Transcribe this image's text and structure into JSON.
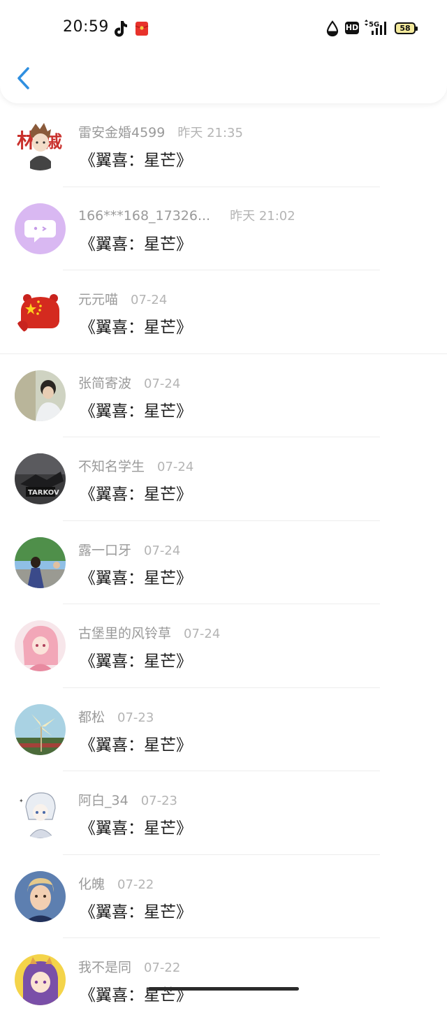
{
  "status_bar": {
    "time": "20:59",
    "network": "5G",
    "hd": "HD",
    "battery": "58"
  },
  "colors": {
    "accent": "#2f8fe0",
    "name_gray": "#9a9a9a"
  },
  "comments": [
    {
      "name": "雷安金婚4599",
      "date": "昨天 21:35",
      "message": "《翼喜：星芒》",
      "avatar": "anime-avatar"
    },
    {
      "name": "166***168_17326...",
      "date": "昨天 21:02",
      "message": "《翼喜：星芒》",
      "avatar": "default-chat-avatar"
    },
    {
      "name": "元元喵",
      "date": "07-24",
      "message": "《翼喜：星芒》",
      "avatar": "red-bear-avatar"
    },
    {
      "name": "张简寄波",
      "date": "07-24",
      "message": "《翼喜：星芒》",
      "avatar": "photo-avatar"
    },
    {
      "name": "不知名学生",
      "date": "07-24",
      "message": "《翼喜：星芒》",
      "avatar": "game-avatar"
    },
    {
      "name": "露一口牙",
      "date": "07-24",
      "message": "《翼喜：星芒》",
      "avatar": "photo-avatar"
    },
    {
      "name": "古堡里的风铃草",
      "date": "07-24",
      "message": "《翼喜：星芒》",
      "avatar": "anime-avatar"
    },
    {
      "name": "都松",
      "date": "07-23",
      "message": "《翼喜：星芒》",
      "avatar": "pinwheel-avatar"
    },
    {
      "name": "阿白_34",
      "date": "07-23",
      "message": "《翼喜：星芒》",
      "avatar": "anime-avatar"
    },
    {
      "name": "化魄",
      "date": "07-22",
      "message": "《翼喜：星芒》",
      "avatar": "photo-avatar"
    },
    {
      "name": "我不是同",
      "date": "07-22",
      "message": "《翼喜：星芒》",
      "avatar": "anime-avatar"
    }
  ]
}
